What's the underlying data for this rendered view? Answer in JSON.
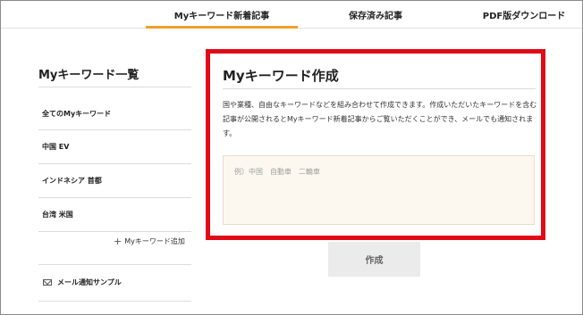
{
  "tabs": [
    {
      "label": "Myキーワード新着記事"
    },
    {
      "label": "保存済み記事"
    },
    {
      "label": "PDF版ダウンロード"
    }
  ],
  "sidebar": {
    "title": "Myキーワード一覧",
    "items": [
      {
        "label": "全てのMyキーワード"
      },
      {
        "label": "中国 EV"
      },
      {
        "label": "インドネシア 首都"
      },
      {
        "label": "台湾 米国"
      }
    ],
    "add_label": "Myキーワード追加",
    "mail_sample_label": "メール通知サンプル"
  },
  "create": {
    "title": "Myキーワード作成",
    "description": "国や業種、自由なキーワードなどを組み合わせて作成できます。作成いただいたキーワードを含む記事が公開されるとMyキーワード新着記事からご覧いただくことができ、メールでも通知されます。",
    "placeholder": "例）中国　自動車　二輪車",
    "button_label": "作成"
  },
  "colors": {
    "active_tab_underline": "#f0a02a",
    "highlight_border": "#e10a17",
    "input_background": "#fdf8ef"
  }
}
